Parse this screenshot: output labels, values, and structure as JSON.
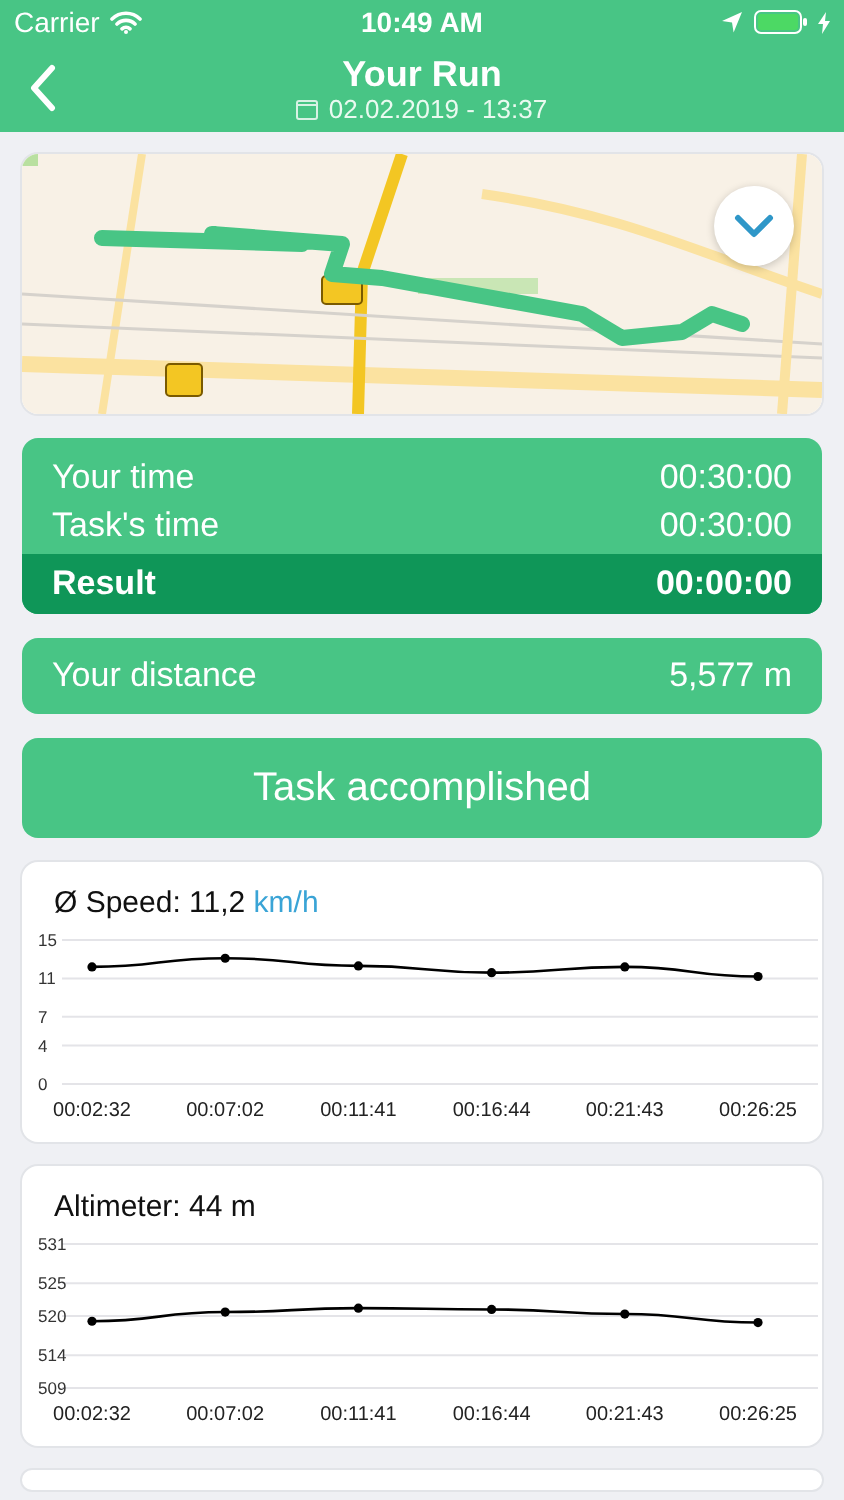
{
  "status_bar": {
    "carrier": "Carrier",
    "time": "10:49 AM"
  },
  "nav": {
    "title": "Your Run",
    "date": "02.02.2019 - 13:37"
  },
  "times": [
    {
      "label": "Your time",
      "value": "00:30:00",
      "highlighted": false
    },
    {
      "label": "Task's time",
      "value": "00:30:00",
      "highlighted": false
    },
    {
      "label": "Result",
      "value": "00:00:00",
      "highlighted": true
    }
  ],
  "distance": {
    "label": "Your distance",
    "value": "5,577 m"
  },
  "action_button": "Task accomplished",
  "charts": [
    {
      "title": "Ø Speed: 11,2 ",
      "unit": "km/h",
      "chart_data": {
        "type": "line",
        "categories": [
          "00:02:32",
          "00:07:02",
          "00:11:41",
          "00:16:44",
          "00:21:43",
          "00:26:25"
        ],
        "series": [
          {
            "color": "#000000",
            "marker": true,
            "values": [
              12.2,
              13.1,
              12.3,
              11.6,
              12.2,
              11.2
            ]
          }
        ],
        "grid": true,
        "ylim": [
          0,
          15
        ],
        "yticks": [
          0,
          4,
          7,
          11,
          15
        ]
      }
    },
    {
      "title": "Altimeter: 44 m",
      "chart_data": {
        "type": "line",
        "categories": [
          "00:02:32",
          "00:07:02",
          "00:11:41",
          "00:16:44",
          "00:21:43",
          "00:26:25"
        ],
        "series": [
          {
            "color": "#000000",
            "marker": true,
            "values": [
              519.2,
              520.6,
              521.2,
              521.0,
              520.3,
              519.0
            ]
          }
        ],
        "grid": true,
        "ylim": [
          509,
          531
        ],
        "yticks": [
          509,
          514,
          520,
          525,
          531
        ]
      }
    }
  ]
}
